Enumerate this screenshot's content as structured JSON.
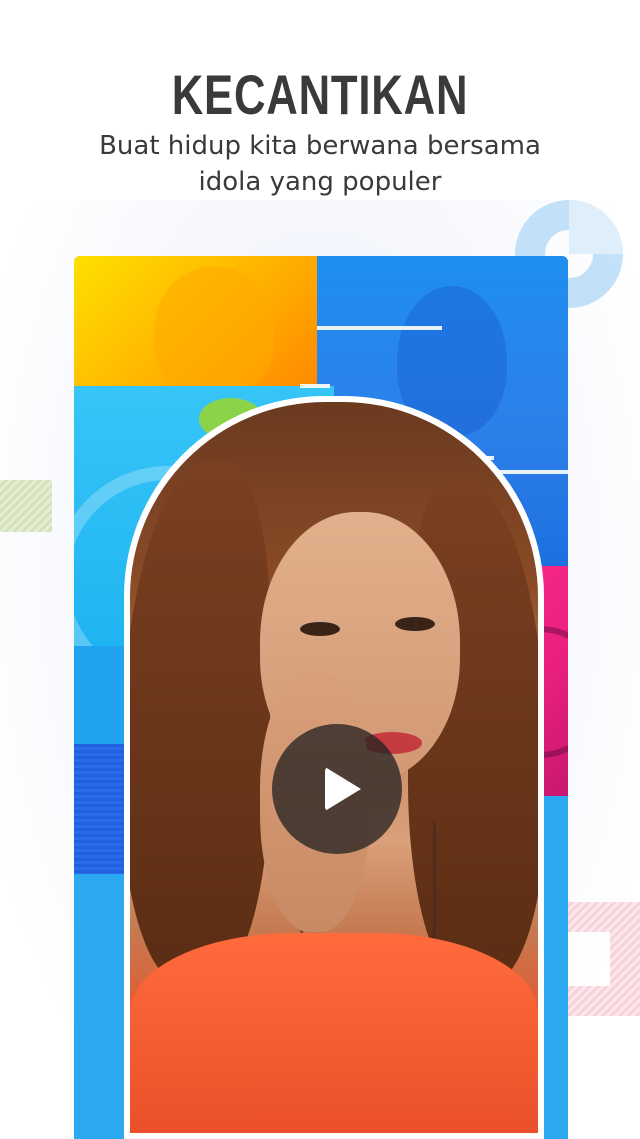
{
  "header": {
    "title": "KECANTIKAN",
    "subtitle": "Buat hidup kita berwana bersama idola yang populer"
  },
  "media": {
    "play_icon": "play-icon"
  },
  "colors": {
    "headline": "#3a3a3a",
    "accent_blue": "#2aa9f1",
    "accent_yellow": "#ffd000",
    "accent_pink": "#ff2d8e",
    "play_bg": "#282422"
  }
}
